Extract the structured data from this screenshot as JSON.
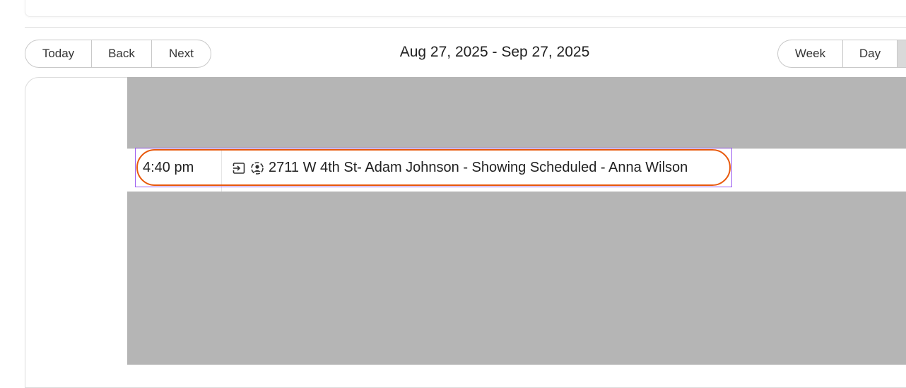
{
  "toolbar": {
    "today_label": "Today",
    "back_label": "Back",
    "next_label": "Next",
    "date_range": "Aug 27, 2025 - Sep 27, 2025",
    "views": [
      "Week",
      "Day"
    ]
  },
  "agenda": {
    "rows": [
      {
        "time": "4:40 pm",
        "icons": [
          "enter-icon",
          "user-circle-icon"
        ],
        "title": "2711 W 4th St- Adam Johnson - Showing Scheduled - Anna Wilson"
      }
    ]
  },
  "colors": {
    "overlay": "#b5b5b5",
    "highlight_outer": "#9b5cf0",
    "highlight_inner": "#e8590c"
  }
}
